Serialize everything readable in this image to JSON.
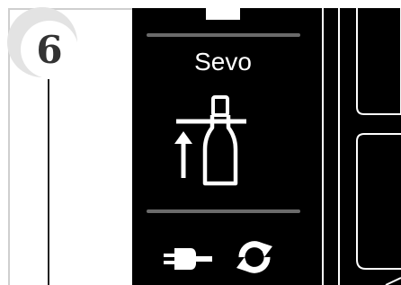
{
  "step": {
    "number": "6"
  },
  "screen": {
    "agent_label": "Sevo",
    "main_icon": "bottle-fill-up-icon",
    "bottom_icons": [
      "plug-icon",
      "refresh-icon"
    ]
  },
  "colors": {
    "screen_background": "#000000",
    "step_ring": "#e3e3e3",
    "separator": "#6a6a6a"
  }
}
